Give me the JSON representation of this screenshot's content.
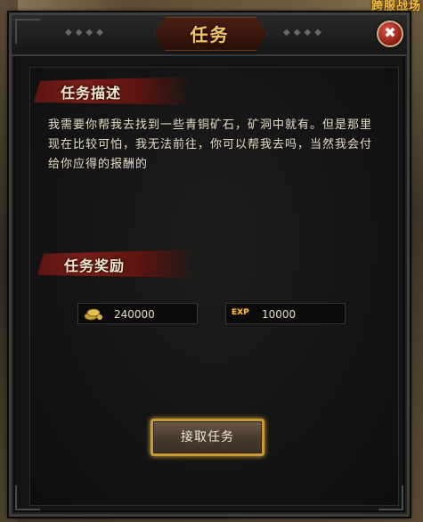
{
  "window": {
    "title": "任务",
    "close_glyph": "✖"
  },
  "background": {
    "corner_badge": "跨服战场"
  },
  "description_section": {
    "heading": "任务描述",
    "text": "我需要你帮我去找到一些青铜矿石，矿洞中就有。但是那里现在比较可怕，我无法前往，你可以帮我去吗，当然我会付给你应得的报酬的"
  },
  "reward_section": {
    "heading": "任务奖励",
    "rewards": [
      {
        "icon": "gold-coins-icon",
        "value": "240000"
      },
      {
        "icon": "exp-icon",
        "icon_label": "EXP",
        "value": "10000"
      }
    ]
  },
  "actions": {
    "accept_label": "接取任务"
  },
  "colors": {
    "title_gold": "#f3c56a",
    "banner_red": "#7a1e18",
    "button_glow": "#e0b040",
    "panel_bg": "#141414"
  }
}
